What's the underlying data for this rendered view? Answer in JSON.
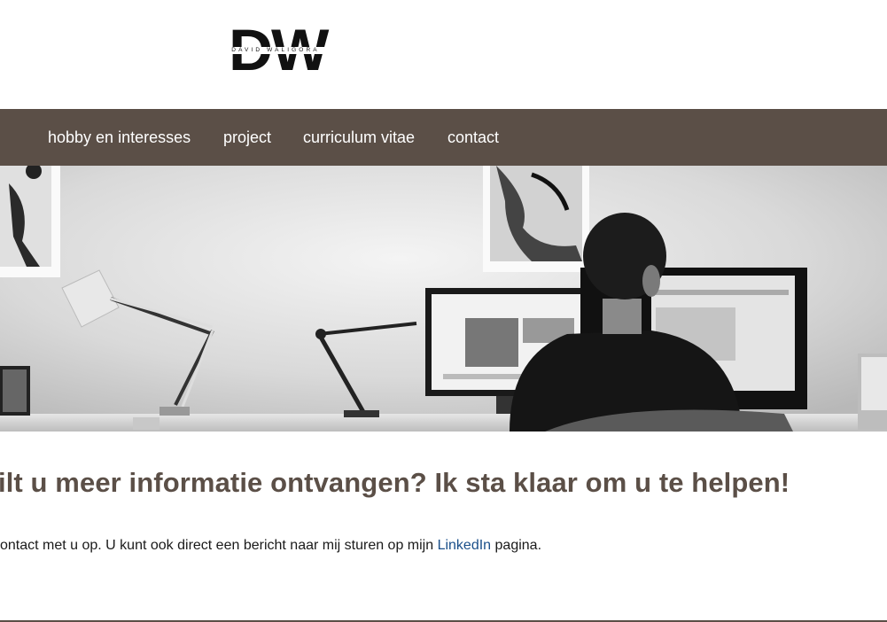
{
  "logo": {
    "letters": "DW",
    "name": "DAVID WALIGORA"
  },
  "nav": {
    "items": [
      {
        "label": "hobby en interesses"
      },
      {
        "label": "project"
      },
      {
        "label": "curriculum vitae"
      },
      {
        "label": "contact"
      }
    ]
  },
  "colors": {
    "nav_background": "#5b4f47",
    "headline": "#5b4f47",
    "link": "#1a4f8a"
  },
  "main": {
    "headline": "ilt u meer informatie ontvangen? Ik sta klaar om u te helpen!",
    "text_before": "ontact met u op. U kunt ook direct een bericht naar mij sturen op mijn ",
    "link_label": "LinkedIn",
    "text_after": " pagina."
  }
}
